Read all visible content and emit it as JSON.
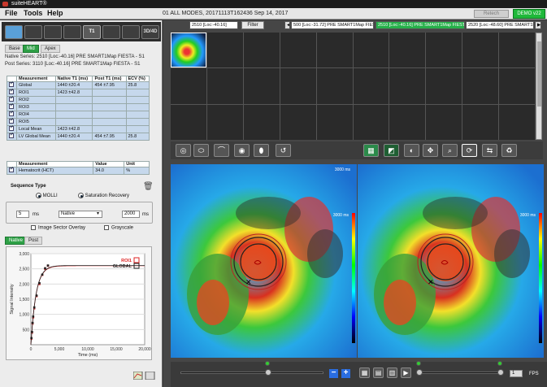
{
  "titlebar": {
    "title": "suiteHEART®"
  },
  "menu": {
    "file": "File",
    "tools": "Tools",
    "help": "Help"
  },
  "header_info": "01 ALL MODES, 20171113T162436   Sep 14, 2017",
  "buttons": {
    "retech": "Retech",
    "demo": "DEMO v22"
  },
  "tool_tabs": [
    "",
    "",
    "",
    "",
    "T1",
    "",
    "",
    "3D/4D"
  ],
  "view_tabs": [
    "Base",
    "Mid",
    "Apex"
  ],
  "native_series": "Native Series: 2510 [Loc:-40.16] PRE SMART1Map FIESTA - S1",
  "post_series": "Post Series:  3110 [Loc:-40.16] PRE SMART1Map FIESTA - S1",
  "table1": {
    "headers": [
      "Measurement",
      "Native T1 (ms)",
      "Post T1 (ms)",
      "ECV (%)"
    ],
    "rows": [
      [
        "Global",
        "1440 ±20.4",
        "454 ±7.95",
        "25.8"
      ],
      [
        "ROI1",
        "1423 ±42.8",
        "",
        ""
      ],
      [
        "ROI2",
        "",
        "",
        ""
      ],
      [
        "ROI3",
        "",
        "",
        ""
      ],
      [
        "ROI4",
        "",
        "",
        ""
      ],
      [
        "ROI5",
        "",
        "",
        ""
      ],
      [
        "Local Mean",
        "1423 ±42.8",
        "",
        ""
      ],
      [
        "LV Global Mean",
        "1440 ±20.4",
        "454 ±7.95",
        "25.8"
      ]
    ]
  },
  "table2": {
    "headers": [
      "Measurement",
      "Value",
      "Unit"
    ],
    "rows": [
      [
        "Hematocrit (HCT)",
        "34.0",
        "%"
      ]
    ]
  },
  "sequence": {
    "title": "Sequence Type",
    "molli": "MOLLI",
    "sat": "Saturation Recovery",
    "field1": "5",
    "unit1": "ms",
    "select1": "Native",
    "field2": "2000",
    "unit2": "ms",
    "overlay": "Image Sector Overlay",
    "grayscale": "Grayscale"
  },
  "graph_tabs": [
    "Native",
    "Post"
  ],
  "chart_data": {
    "type": "line",
    "xlabel": "Time (ms)",
    "ylabel": "Signal Intensity",
    "xlim": [
      0,
      20000
    ],
    "ylim": [
      0,
      3000
    ],
    "xticks": [
      "0",
      "5,000",
      "10,000",
      "15,000",
      "20,000"
    ],
    "yticks": [
      "500",
      "1,000",
      "1,500",
      "2,000",
      "2,500",
      "3,000"
    ],
    "legend": [
      "ROI1",
      "GLOBAL"
    ],
    "series": [
      {
        "name": "ROI1",
        "color": "#d22",
        "x": [
          100,
          200,
          300,
          400,
          600,
          1000,
          1500,
          2000,
          2500,
          3000
        ],
        "y": [
          200,
          400,
          700,
          900,
          1200,
          1600,
          2000,
          2300,
          2500,
          2600
        ]
      },
      {
        "name": "GLOBAL",
        "color": "#222",
        "x": [
          100,
          200,
          300,
          400,
          600,
          1000,
          1500,
          2000,
          2500,
          3000
        ],
        "y": [
          220,
          420,
          720,
          930,
          1230,
          1620,
          2030,
          2310,
          2520,
          2610
        ]
      }
    ]
  },
  "thumb_nav": {
    "series_dropdown": "2510 [Loc:-40.16]",
    "filter": "Filter",
    "items": [
      "500 [Loc:-31.72] PRE SMART1Map FIESTA",
      "2510 [Loc:-40.16] PRE SMART1Map FIESTA",
      "2520 [Loc:-48.60] PRE SMART1Map FIESTA"
    ]
  },
  "viewer_labels": {
    "scale_top": "3000 ms",
    "scale_mid": "0 ms"
  },
  "fps": "FPS",
  "fps_value": "1"
}
